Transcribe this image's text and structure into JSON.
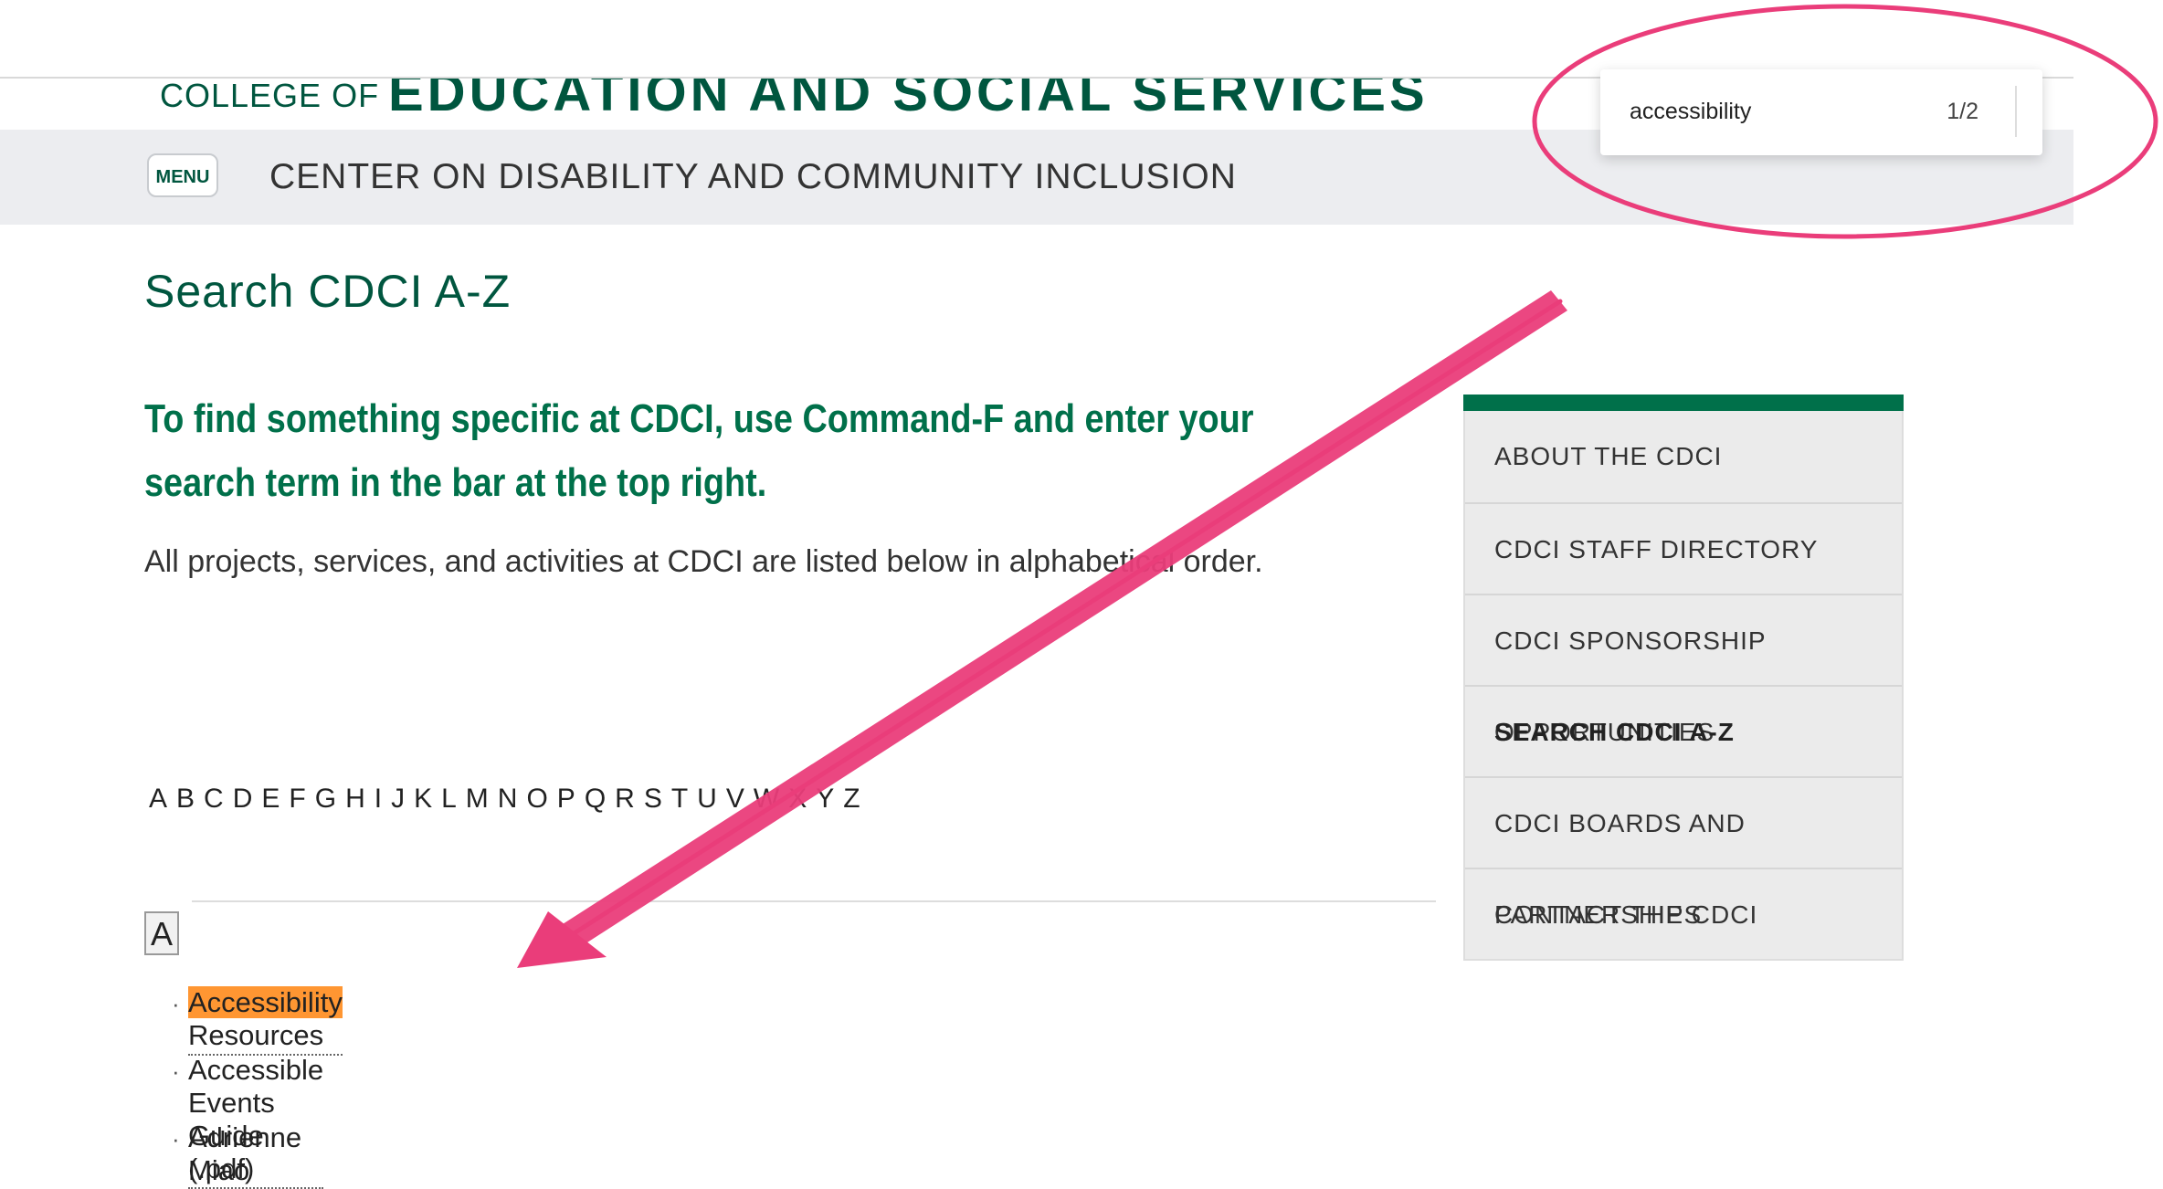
{
  "header": {
    "college_prefix": "COLLEGE OF",
    "college_name": "EDUCATION AND SOCIAL SERVICES",
    "menu_label": "MENU",
    "unit_title": "CENTER ON DISABILITY AND COMMUNITY INCLUSION"
  },
  "find_bar": {
    "query": "accessibility",
    "match_count": "1/2"
  },
  "main": {
    "page_title": "Search CDCI A-Z",
    "intro_heading": "To find something specific at CDCI, use Command-F and enter your search term in the bar at the top right.",
    "intro_text": "All projects, services, and activities at CDCI are listed below in alphabetical order.",
    "alphabet": [
      "A",
      "B",
      "C",
      "D",
      "E",
      "F",
      "G",
      "H",
      "I",
      "J",
      "K",
      "L",
      "M",
      "N",
      "O",
      "P",
      "Q",
      "R",
      "S",
      "T",
      "U",
      "V",
      "W",
      "X",
      "Y",
      "Z"
    ],
    "section_letter": "A",
    "items": [
      {
        "highlight": "Accessibility",
        "rest": " Resources"
      },
      {
        "label": "Accessible Events Guide (.pdf)"
      },
      {
        "label": "Adrienne Miao"
      }
    ]
  },
  "sidebar": {
    "items": [
      {
        "label": "ABOUT THE CDCI"
      },
      {
        "label": "CDCI STAFF DIRECTORY"
      },
      {
        "label": "CDCI SPONSORSHIP OPPORTUNITIES"
      },
      {
        "label": "SEARCH CDCI A-Z"
      },
      {
        "label": "CDCI BOARDS AND PARTNERSHIPS"
      },
      {
        "label": "CONTACT THE CDCI"
      }
    ]
  },
  "colors": {
    "brand_green": "#00563f",
    "heading_green": "#00704a",
    "annotation_pink": "#ea3d7a",
    "find_highlight": "#ff9632"
  }
}
